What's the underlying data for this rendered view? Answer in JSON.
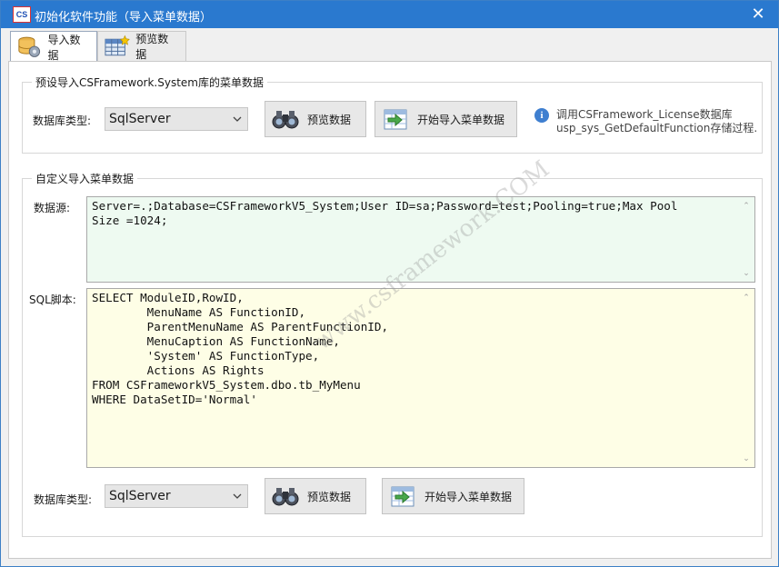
{
  "window": {
    "app_icon_text": "CS",
    "title": "初始化软件功能（导入菜单数据）",
    "close_glyph": "✕"
  },
  "tabs": [
    {
      "label": "导入数据",
      "icon": "database-gear-icon",
      "active": true
    },
    {
      "label": "预览数据",
      "icon": "table-grid-icon",
      "active": false
    }
  ],
  "preset_group": {
    "legend": "预设导入CSFramework.System库的菜单数据",
    "db_type_label": "数据库类型:",
    "db_type_value": "SqlServer",
    "preview_button": "预览数据",
    "import_button": "开始导入菜单数据",
    "info_line1": "调用CSFramework_License数据库",
    "info_line2": "usp_sys_GetDefaultFunction存储过程."
  },
  "custom_group": {
    "legend": "自定义导入菜单数据",
    "datasource_label": "数据源:",
    "datasource_value": "Server=.;Database=CSFrameworkV5_System;User ID=sa;Password=test;Pooling=true;Max Pool\nSize =1024;",
    "sql_label": "SQL脚本:",
    "sql_value": "SELECT ModuleID,RowID,\n        MenuName AS FunctionID,\n        ParentMenuName AS ParentFunctionID,\n        MenuCaption AS FunctionName,\n        'System' AS FunctionType,\n        Actions AS Rights\nFROM CSFrameworkV5_System.dbo.tb_MyMenu\nWHERE DataSetID='Normal'",
    "db_type_label": "数据库类型:",
    "db_type_value": "SqlServer",
    "preview_button": "预览数据",
    "import_button": "开始导入菜单数据"
  },
  "watermark": "www.csframework.COM",
  "colors": {
    "titlebar": "#2a79cf",
    "datasource_bg": "#eefaf1",
    "sql_bg": "#fefee6"
  }
}
